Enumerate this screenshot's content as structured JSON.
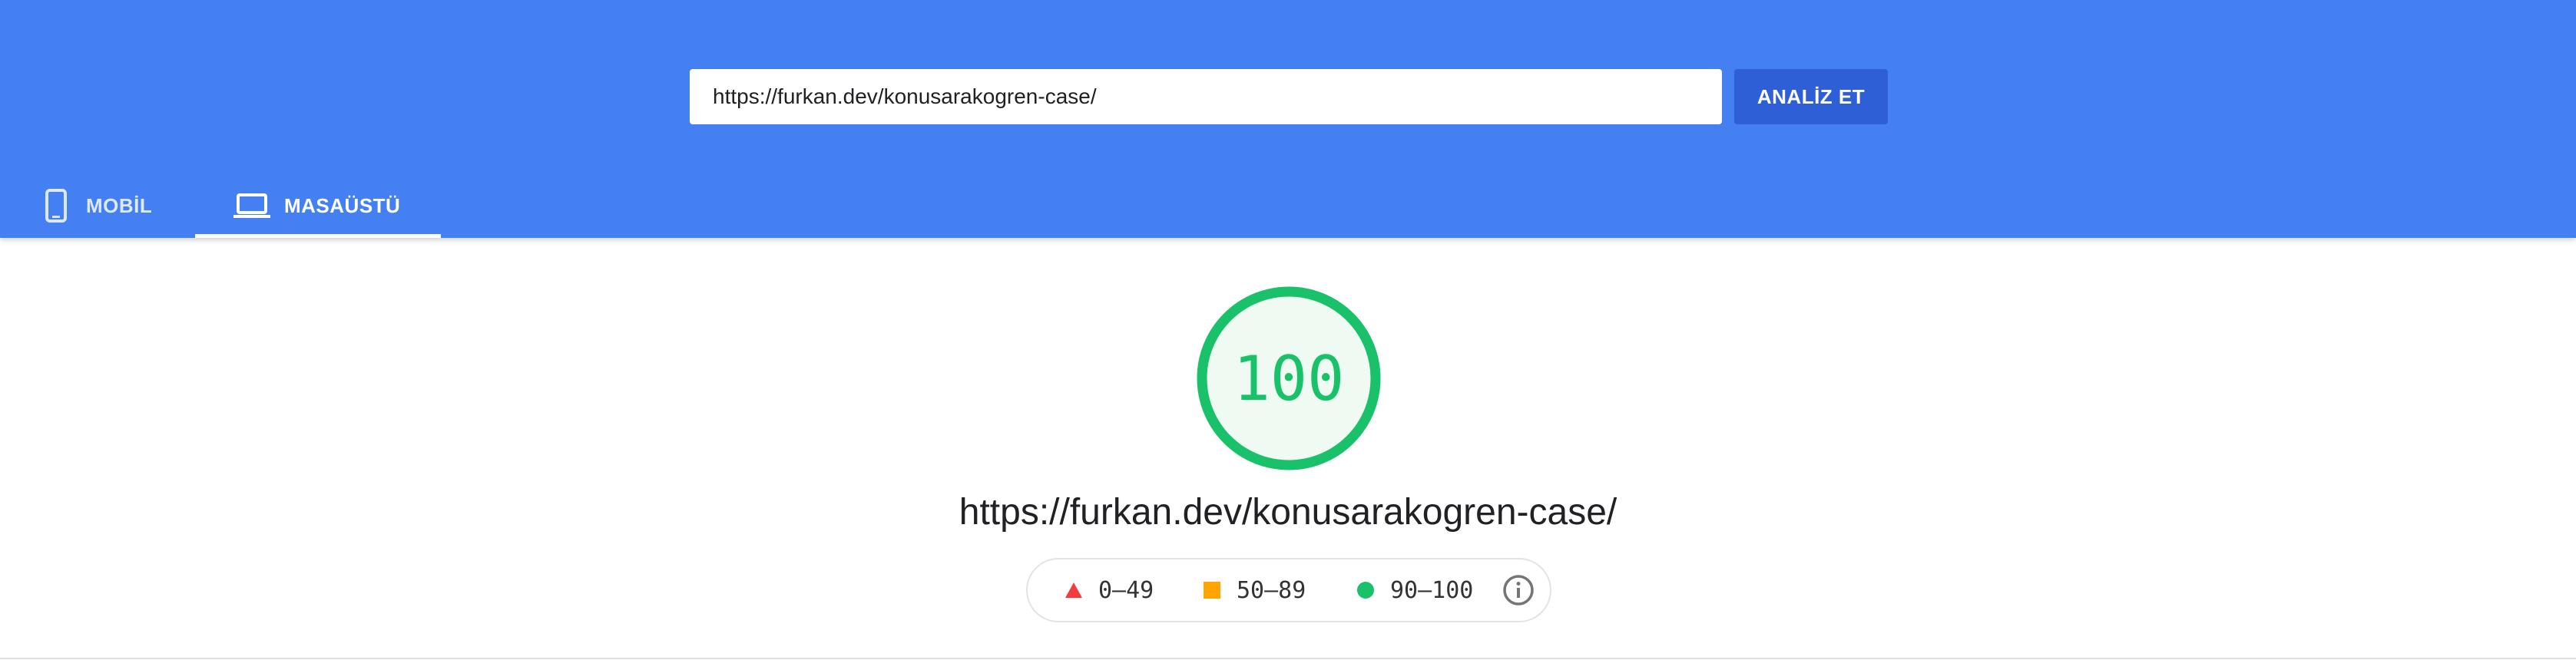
{
  "search": {
    "url_value": "https://furkan.dev/konusarakogren-case/",
    "analyze_label": "ANALİZ ET"
  },
  "tabs": [
    {
      "label": "MOBİL",
      "icon": "phone-icon",
      "selected": false
    },
    {
      "label": "MASAÜSTÜ",
      "icon": "laptop-icon",
      "selected": true
    }
  ],
  "score": {
    "value": "100",
    "fraction": 1.0,
    "color": "#19c26a"
  },
  "page_url": "https://furkan.dev/konusarakogren-case/",
  "legend": [
    {
      "range": "0–49",
      "shape": "triangle",
      "color": "#f33d3d"
    },
    {
      "range": "50–89",
      "shape": "square",
      "color": "#ffa400"
    },
    {
      "range": "90–100",
      "shape": "circle",
      "color": "#19c26a"
    }
  ],
  "colors": {
    "header": "#4580f2",
    "button": "#2f5fd7"
  }
}
